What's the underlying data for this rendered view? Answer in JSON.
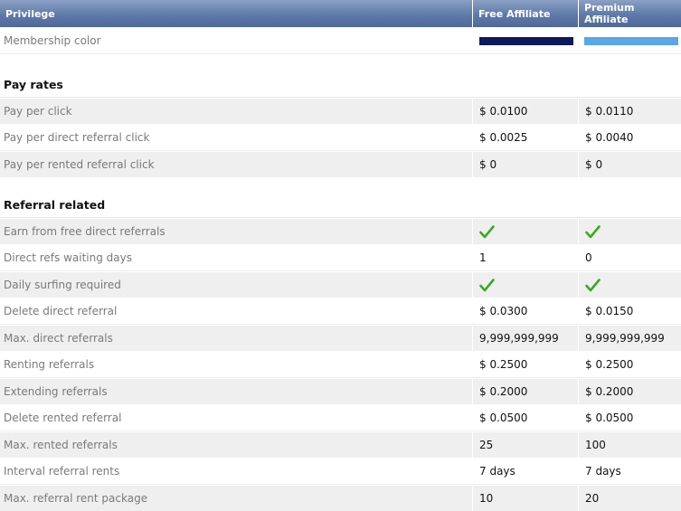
{
  "header": {
    "col1": "Privilege",
    "col2": "Free Affiliate",
    "col3": "Premium Affiliate"
  },
  "membership": {
    "label": "Membership color",
    "free_color": "#0e1a5a",
    "premium_color": "#5aa7e6"
  },
  "sections": {
    "pay_rates": "Pay rates",
    "referral_related": "Referral related"
  },
  "pay_rates": [
    {
      "label": "Pay per click",
      "free": "$ 0.0100",
      "premium": "$ 0.0110"
    },
    {
      "label": "Pay per direct referral click",
      "free": "$ 0.0025",
      "premium": "$ 0.0040"
    },
    {
      "label": "Pay per rented referral click",
      "free": "$ 0",
      "premium": "$ 0"
    }
  ],
  "referral": [
    {
      "label": "Earn from free direct referrals",
      "free_check": true,
      "premium_check": true
    },
    {
      "label": "Direct refs waiting days",
      "free": "1",
      "premium": "0"
    },
    {
      "label": "Daily surfing required",
      "free_check": true,
      "premium_check": true
    },
    {
      "label": "Delete direct referral",
      "free": "$ 0.0300",
      "premium": "$ 0.0150"
    },
    {
      "label": "Max. direct referrals",
      "free": "9,999,999,999",
      "premium": "9,999,999,999"
    },
    {
      "label": "Renting referrals",
      "free": "$ 0.2500",
      "premium": "$ 0.2500"
    },
    {
      "label": "Extending referrals",
      "free": "$ 0.2000",
      "premium": "$ 0.2000"
    },
    {
      "label": "Delete rented referral",
      "free": "$ 0.0500",
      "premium": "$ 0.0500"
    },
    {
      "label": "Max. rented referrals",
      "free": "25",
      "premium": "100"
    },
    {
      "label": "Interval referral rents",
      "free": "7 days",
      "premium": "7 days"
    },
    {
      "label": "Max. referral rent package",
      "free": "10",
      "premium": "20"
    }
  ],
  "check_color": "#3aaa1f"
}
